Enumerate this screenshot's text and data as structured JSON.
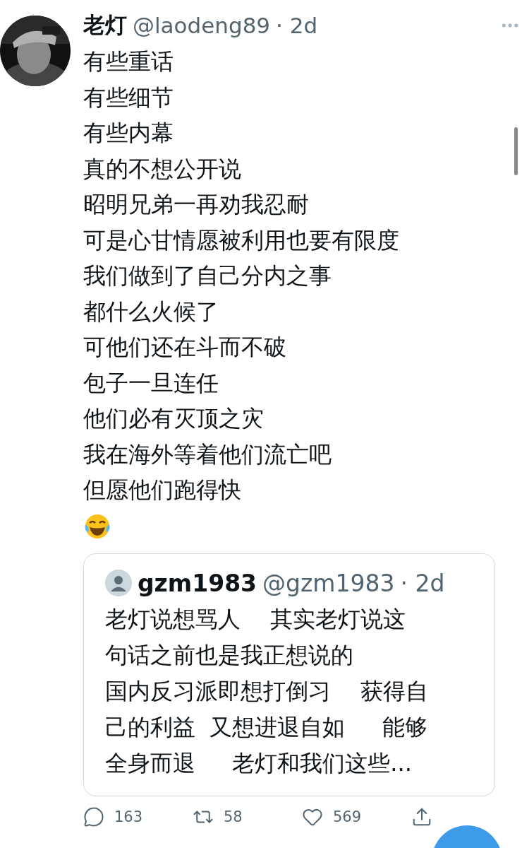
{
  "tweet": {
    "name": "老灯",
    "handle": "@laodeng89",
    "time": "· 2d",
    "lines": [
      "有些重话",
      "有些细节",
      "有些内幕",
      "真的不想公开说",
      "昭明兄弟一再劝我忍耐",
      "可是心甘情愿被利用也要有限度",
      "我们做到了自己分内之事",
      "都什么火候了",
      "可他们还在斗而不破",
      "包子一旦连任",
      "他们必有灭顶之灾",
      "我在海外等着他们流亡吧",
      "但愿他们跑得快"
    ],
    "quote": {
      "name": "gzm1983",
      "handle": "@gzm1983",
      "time": "· 2d",
      "lines": [
        "老灯说想骂人　 其实老灯说这",
        "句话之前也是我正想说的",
        "国内反习派即想打倒习　 获得自",
        "己的利益  又想进退自如　  能够",
        "全身而退　  老灯和我们这些..."
      ]
    },
    "actions": [
      {
        "kind": "reply",
        "count": "163"
      },
      {
        "kind": "retweet",
        "count": "58"
      },
      {
        "kind": "like",
        "count": "569"
      },
      {
        "kind": "share"
      }
    ]
  }
}
